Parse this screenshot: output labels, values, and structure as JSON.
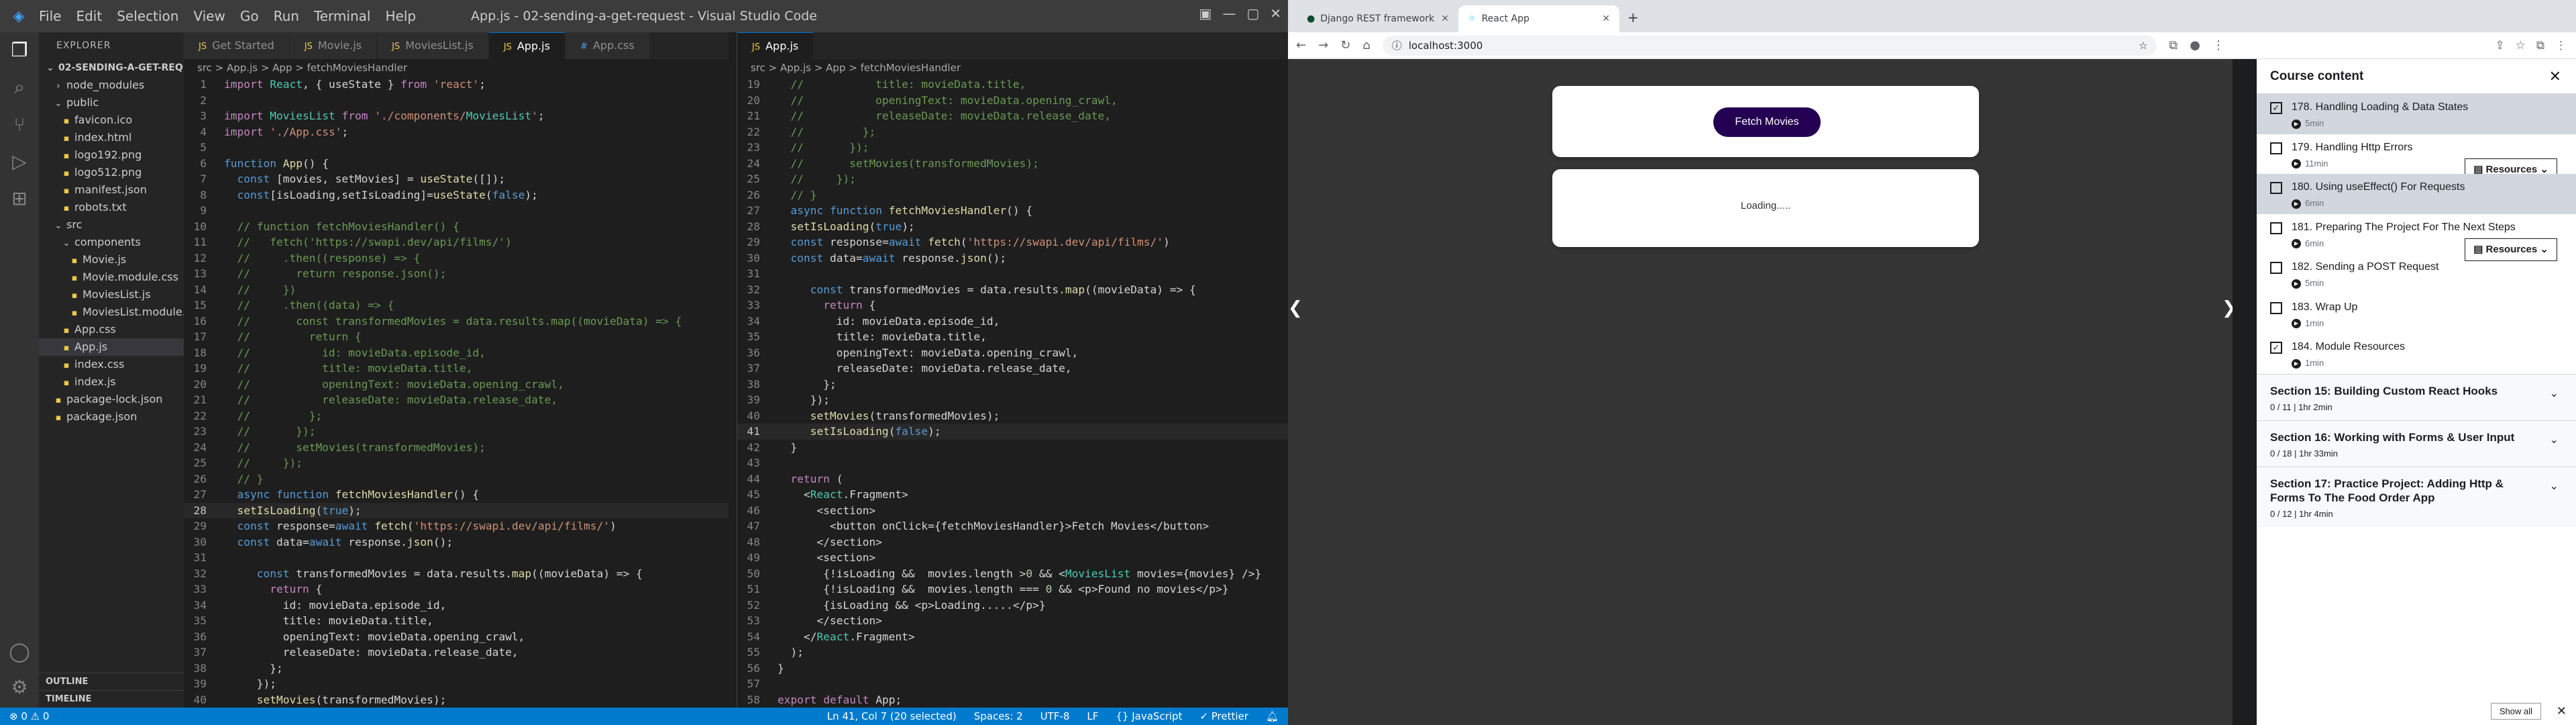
{
  "vscode": {
    "title": "App.js - 02-sending-a-get-request - Visual Studio Code",
    "menu": [
      "File",
      "Edit",
      "Selection",
      "View",
      "Go",
      "Run",
      "Terminal",
      "Help"
    ],
    "explorer_label": "EXPLORER",
    "project": "02-SENDING-A-GET-REQU...",
    "tree": [
      {
        "label": "node_modules",
        "indent": 1,
        "kind": "folder-closed"
      },
      {
        "label": "public",
        "indent": 1,
        "kind": "folder-open"
      },
      {
        "label": "favicon.ico",
        "indent": 2,
        "kind": "file"
      },
      {
        "label": "index.html",
        "indent": 2,
        "kind": "file"
      },
      {
        "label": "logo192.png",
        "indent": 2,
        "kind": "file"
      },
      {
        "label": "logo512.png",
        "indent": 2,
        "kind": "file"
      },
      {
        "label": "manifest.json",
        "indent": 2,
        "kind": "file"
      },
      {
        "label": "robots.txt",
        "indent": 2,
        "kind": "file"
      },
      {
        "label": "src",
        "indent": 1,
        "kind": "folder-open"
      },
      {
        "label": "components",
        "indent": 2,
        "kind": "folder-open"
      },
      {
        "label": "Movie.js",
        "indent": 3,
        "kind": "file"
      },
      {
        "label": "Movie.module.css",
        "indent": 3,
        "kind": "file"
      },
      {
        "label": "MoviesList.js",
        "indent": 3,
        "kind": "file"
      },
      {
        "label": "MoviesList.module...",
        "indent": 3,
        "kind": "file"
      },
      {
        "label": "App.css",
        "indent": 2,
        "kind": "file"
      },
      {
        "label": "App.js",
        "indent": 2,
        "kind": "file",
        "selected": true
      },
      {
        "label": "index.css",
        "indent": 2,
        "kind": "file"
      },
      {
        "label": "index.js",
        "indent": 2,
        "kind": "file"
      },
      {
        "label": "package-lock.json",
        "indent": 1,
        "kind": "file"
      },
      {
        "label": "package.json",
        "indent": 1,
        "kind": "file"
      }
    ],
    "outline": "OUTLINE",
    "timeline": "TIMELINE",
    "left_tabs": [
      "Get Started",
      "Movie.js",
      "MoviesList.js",
      "App.js",
      "App.css"
    ],
    "right_tabs": [
      "App.js"
    ],
    "left_breadcrumb": "src > App.js > App > fetchMoviesHandler",
    "right_breadcrumb": "src > App.js > App > fetchMoviesHandler",
    "left_code": {
      "start": 1,
      "cur": 28,
      "lines": [
        "import React, { useState } from 'react';",
        "",
        "import MoviesList from './components/MoviesList';",
        "import './App.css';",
        "",
        "function App() {",
        "  const [movies, setMovies] = useState([]);",
        "  const[isLoading,setIsLoading]=useState(false);",
        "",
        "  // function fetchMoviesHandler() {",
        "  //   fetch('https://swapi.dev/api/films/')",
        "  //     .then((response) => {",
        "  //       return response.json();",
        "  //     })",
        "  //     .then((data) => {",
        "  //       const transformedMovies = data.results.map((movieData) => {",
        "  //         return {",
        "  //           id: movieData.episode_id,",
        "  //           title: movieData.title,",
        "  //           openingText: movieData.opening_crawl,",
        "  //           releaseDate: movieData.release_date,",
        "  //         };",
        "  //       });",
        "  //       setMovies(transformedMovies);",
        "  //     });",
        "  // }",
        "  async function fetchMoviesHandler() {",
        "  setIsLoading(true);",
        "  const response=await fetch('https://swapi.dev/api/films/')",
        "  const data=await response.json();",
        "",
        "     const transformedMovies = data.results.map((movieData) => {",
        "       return {",
        "         id: movieData.episode_id,",
        "         title: movieData.title,",
        "         openingText: movieData.opening_crawl,",
        "         releaseDate: movieData.release_date,",
        "       };",
        "     });",
        "     setMovies(transformedMovies);"
      ]
    },
    "right_code": {
      "start": 19,
      "cur": 41,
      "lines": [
        "  //           title: movieData.title,",
        "  //           openingText: movieData.opening_crawl,",
        "  //           releaseDate: movieData.release_date,",
        "  //         };",
        "  //       });",
        "  //       setMovies(transformedMovies);",
        "  //     });",
        "  // }",
        "  async function fetchMoviesHandler() {",
        "  setIsLoading(true);",
        "  const response=await fetch('https://swapi.dev/api/films/')",
        "  const data=await response.json();",
        "",
        "     const transformedMovies = data.results.map((movieData) => {",
        "       return {",
        "         id: movieData.episode_id,",
        "         title: movieData.title,",
        "         openingText: movieData.opening_crawl,",
        "         releaseDate: movieData.release_date,",
        "       };",
        "     });",
        "     setMovies(transformedMovies);",
        "     setIsLoading(false);",
        "  }",
        "",
        "  return (",
        "    <React.Fragment>",
        "      <section>",
        "        <button onClick={fetchMoviesHandler}>Fetch Movies</button>",
        "      </section>",
        "      <section>",
        "       {!isLoading &&  movies.length >0 && <MoviesList movies={movies} />}",
        "       {!isLoading &&  movies.length === 0 && <p>Found no movies</p>}",
        "       {isLoading && <p>Loading.....</p>}",
        "      </section>",
        "    </React.Fragment>",
        "  );",
        "}",
        "",
        "export default App;"
      ]
    },
    "status": {
      "left": "⊗ 0 ⚠ 0",
      "position": "Ln 41, Col 7 (20 selected)",
      "spaces": "Spaces: 2",
      "encoding": "UTF-8",
      "eol": "LF",
      "language": "{} JavaScript",
      "prettier": "✓ Prettier"
    }
  },
  "browser": {
    "tabs": [
      {
        "label": "Django REST framework",
        "active": false
      },
      {
        "label": "React App",
        "active": true
      }
    ],
    "url": "localhost:3000",
    "fetch_button": "Fetch Movies",
    "loading_text": "Loading....."
  },
  "udemy": {
    "heading": "Course content",
    "lectures": [
      {
        "title": "178. Handling Loading & Data States",
        "dur": "5min",
        "checked": true,
        "hl": true,
        "res": false
      },
      {
        "title": "179. Handling Http Errors",
        "dur": "11min",
        "checked": false,
        "hl": false,
        "res": true
      },
      {
        "title": "180. Using useEffect() For Requests",
        "dur": "6min",
        "checked": false,
        "hl": true,
        "res": false
      },
      {
        "title": "181. Preparing The Project For The Next Steps",
        "dur": "6min",
        "checked": false,
        "hl": false,
        "res": true
      },
      {
        "title": "182. Sending a POST Request",
        "dur": "5min",
        "checked": false,
        "hl": false,
        "res": false
      },
      {
        "title": "183. Wrap Up",
        "dur": "1min",
        "checked": false,
        "hl": false,
        "res": false
      },
      {
        "title": "184. Module Resources",
        "dur": "1min",
        "checked": true,
        "hl": false,
        "res": false
      }
    ],
    "resources_label": "Resources",
    "sections": [
      {
        "title": "Section 15: Building Custom React Hooks",
        "meta": "0 / 11 | 1hr 2min"
      },
      {
        "title": "Section 16: Working with Forms & User Input",
        "meta": "0 / 18 | 1hr 33min"
      },
      {
        "title": "Section 17: Practice Project: Adding Http & Forms To The Food Order App",
        "meta": "0 / 12 | 1hr 4min"
      }
    ],
    "show_all": "Show all"
  },
  "colors": {
    "accent": "#007acc",
    "fetch_button": "#230052",
    "udemy_highlight": "#d1d7dc"
  }
}
